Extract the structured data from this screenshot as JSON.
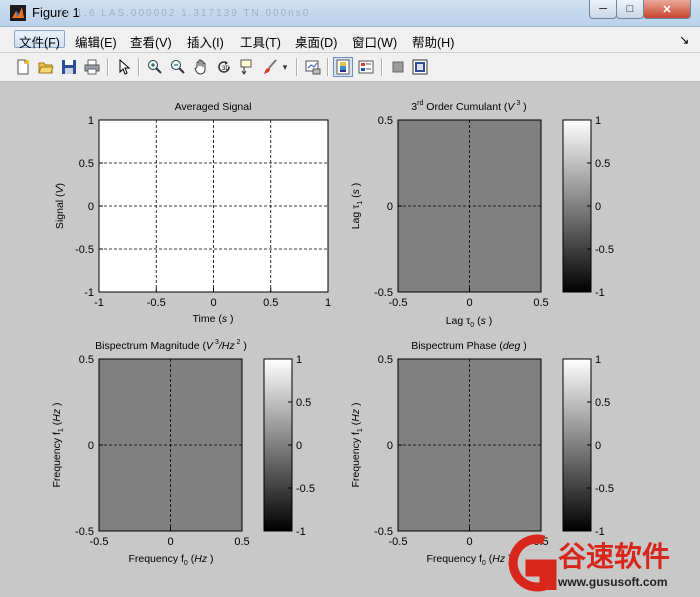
{
  "window": {
    "title": "Figure 1",
    "ghost_text": "fs  1.6  LAS.000002  1.317139  TN.000ns0",
    "controls": {
      "minimize": "─",
      "maximize": "□",
      "close": "✕"
    }
  },
  "menu": [
    "文件(F)",
    "编辑(E)",
    "查看(V)",
    "插入(I)",
    "工具(T)",
    "桌面(D)",
    "窗口(W)",
    "帮助(H)"
  ],
  "menu_arrow": "↘",
  "toolbar": [
    "new-file-icon",
    "open-folder-icon",
    "save-icon",
    "print-icon",
    "pointer-icon",
    "zoom-in-icon",
    "zoom-out-icon",
    "pan-hand-icon",
    "rotate-3d-icon",
    "data-cursor-icon",
    "brush-icon",
    "brush-dropdown-icon",
    "link-plot-icon",
    "colorbar-icon",
    "legend-icon",
    "hide-plot-tools-icon",
    "show-plot-tools-icon"
  ],
  "watermark": {
    "brand": "谷速软件",
    "url": "www.gususoft.com",
    "color": "#d9261c"
  },
  "chart_data": [
    {
      "type": "line",
      "title": "Averaged Signal",
      "xlabel": "Time (s)",
      "ylabel": "Signal (V)",
      "xlim": [
        -1,
        1
      ],
      "ylim": [
        -1,
        1
      ],
      "xticks": [
        "-1",
        "-0.5",
        "0",
        "0.5",
        "1"
      ],
      "yticks": [
        "1",
        "0.5",
        "0",
        "-0.5",
        "-1"
      ],
      "grid": true,
      "background": "#ffffff",
      "series": []
    },
    {
      "type": "heatmap",
      "title": "3rd Order Cumulant (V3)",
      "xlabel": "Lag τ0 (s)",
      "ylabel": "Lag τ1 (s)",
      "xlim": [
        -0.5,
        0.5
      ],
      "ylim": [
        -0.5,
        0.5
      ],
      "xticks": [
        "-0.5",
        "0",
        "0.5"
      ],
      "yticks": [
        "0.5",
        "0",
        "-0.5"
      ],
      "fill_value": 0,
      "fill_color": "#808080",
      "colorbar": {
        "range": [
          -1,
          1
        ],
        "ticks": [
          "1",
          "0.5",
          "0",
          "-0.5",
          "-1"
        ]
      }
    },
    {
      "type": "heatmap",
      "title": "Bispectrum Magnitude (V3/Hz2)",
      "xlabel": "Frequency f0 (Hz)",
      "ylabel": "Frequency f1 (Hz)",
      "xlim": [
        -0.5,
        0.5
      ],
      "ylim": [
        -0.5,
        0.5
      ],
      "xticks": [
        "-0.5",
        "0",
        "0.5"
      ],
      "yticks": [
        "0.5",
        "0",
        "-0.5"
      ],
      "fill_value": 0,
      "fill_color": "#808080",
      "colorbar": {
        "range": [
          -1,
          1
        ],
        "ticks": [
          "1",
          "0.5",
          "0",
          "-0.5",
          "-1"
        ]
      }
    },
    {
      "type": "heatmap",
      "title": "Bispectrum Phase (deg)",
      "xlabel": "Frequency f0 (Hz)",
      "ylabel": "Frequency f1 (Hz)",
      "xlim": [
        -0.5,
        0.5
      ],
      "ylim": [
        -0.5,
        0.5
      ],
      "xticks": [
        "-0.5",
        "0",
        "0.5"
      ],
      "yticks": [
        "0.5",
        "0",
        "-0.5"
      ],
      "fill_value": 0,
      "fill_color": "#808080",
      "colorbar": {
        "range": [
          -1,
          1
        ],
        "ticks": [
          "1",
          "0.5",
          "0",
          "-0.5",
          "-1"
        ]
      }
    }
  ]
}
